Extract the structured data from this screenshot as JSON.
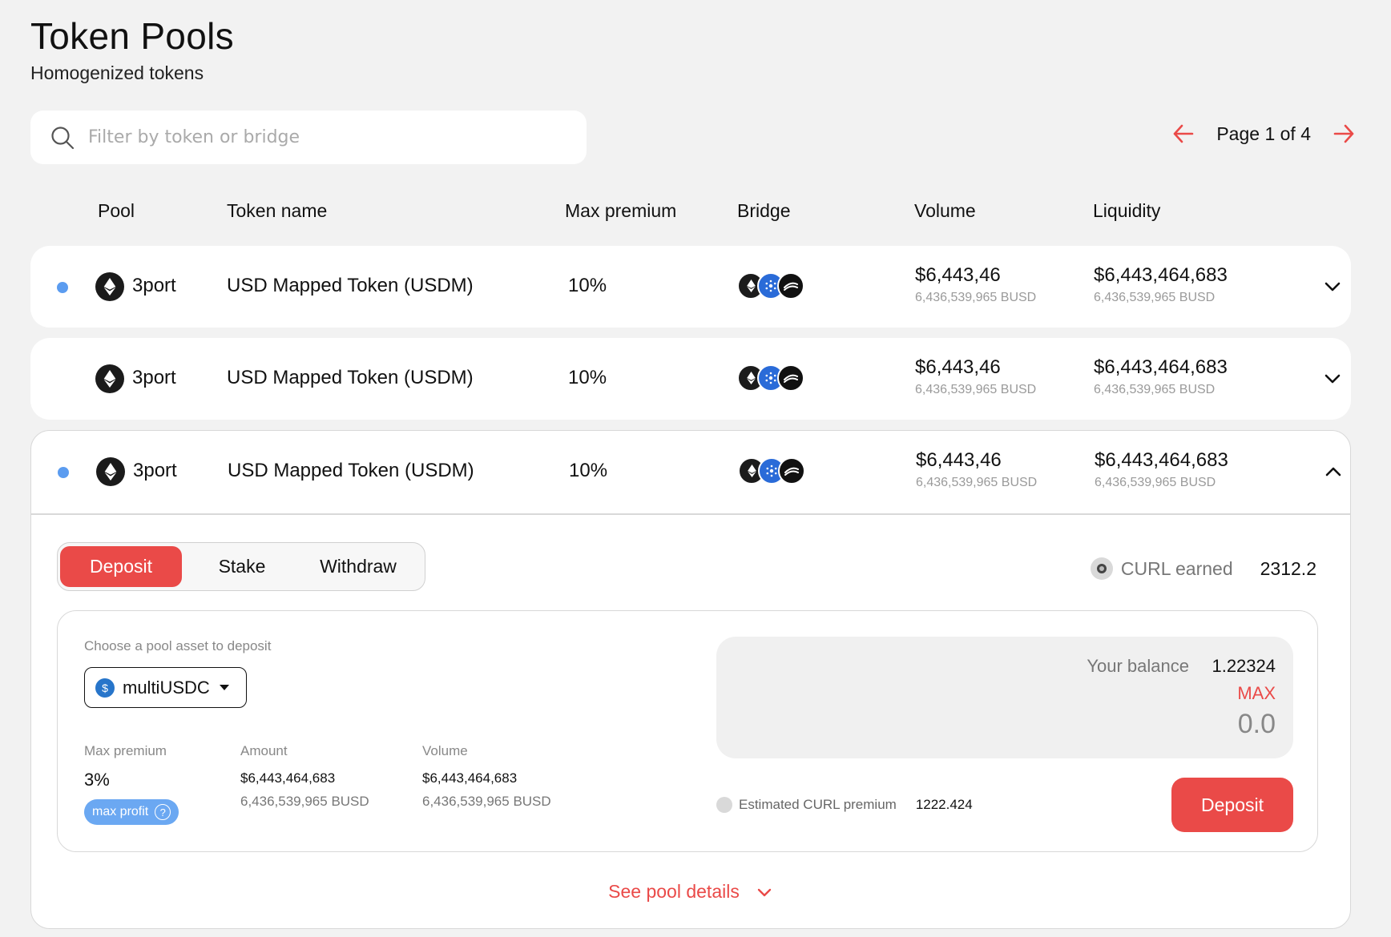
{
  "header": {
    "title": "Token Pools",
    "subtitle": "Homogenized tokens"
  },
  "search": {
    "placeholder": "Filter by token or bridge",
    "icon": "search-icon"
  },
  "pagination": {
    "label": "Page 1 of 4",
    "prev_icon": "arrow-left-icon",
    "next_icon": "arrow-right-icon",
    "accent": "#ea4a48"
  },
  "table": {
    "columns": [
      "Pool",
      "Token name",
      "Max premium",
      "Bridge",
      "Volume",
      "Liquidity"
    ],
    "rows": [
      {
        "unread": true,
        "pool": "3port",
        "token_name": "USD Mapped Token (USDM)",
        "max_premium": "10%",
        "bridges": [
          "ethereum-icon",
          "cardano-icon",
          "bridge-icon"
        ],
        "volume": "$6,443,46",
        "volume_sub": "6,436,539,965 BUSD",
        "liquidity": "$6,443,464,683",
        "liquidity_sub": "6,436,539,965 BUSD",
        "expanded": false
      },
      {
        "unread": false,
        "pool": "3port",
        "token_name": "USD Mapped Token (USDM)",
        "max_premium": "10%",
        "bridges": [
          "ethereum-icon",
          "cardano-icon",
          "bridge-icon"
        ],
        "volume": "$6,443,46",
        "volume_sub": "6,436,539,965 BUSD",
        "liquidity": "$6,443,464,683",
        "liquidity_sub": "6,436,539,965 BUSD",
        "expanded": false
      },
      {
        "unread": true,
        "pool": "3port",
        "token_name": "USD Mapped Token (USDM)",
        "max_premium": "10%",
        "bridges": [
          "ethereum-icon",
          "cardano-icon",
          "bridge-icon"
        ],
        "volume": "$6,443,46",
        "volume_sub": "6,436,539,965 BUSD",
        "liquidity": "$6,443,464,683",
        "liquidity_sub": "6,436,539,965 BUSD",
        "expanded": true
      }
    ]
  },
  "detail": {
    "tabs": [
      {
        "label": "Deposit",
        "active": true
      },
      {
        "label": "Stake",
        "active": false
      },
      {
        "label": "Withdraw",
        "active": false
      }
    ],
    "curl_earned_label": "CURL earned",
    "curl_earned_value": "2312.2",
    "choose_label": "Choose a pool asset to deposit",
    "asset": "multiUSDC",
    "stats": {
      "max_premium_label": "Max premium",
      "max_premium_value": "3%",
      "badge": "max profit",
      "amount_label": "Amount",
      "amount_value": "$6,443,464,683",
      "amount_sub": "6,436,539,965 BUSD",
      "volume_label": "Volume",
      "volume_value": "$6,443,464,683",
      "volume_sub": "6,436,539,965 BUSD"
    },
    "balance_label": "Your balance",
    "balance_value": "1.22324",
    "max_label": "MAX",
    "amount_input_value": "0.0",
    "estimated_label": "Estimated CURL premium",
    "estimated_value": "1222.424",
    "deposit_button": "Deposit",
    "see_details": "See pool details"
  },
  "colors": {
    "background": "#f2f2f2",
    "accent": "#ea4a48",
    "dot": "#5b9cf0",
    "badge": "#6ba8f2"
  }
}
